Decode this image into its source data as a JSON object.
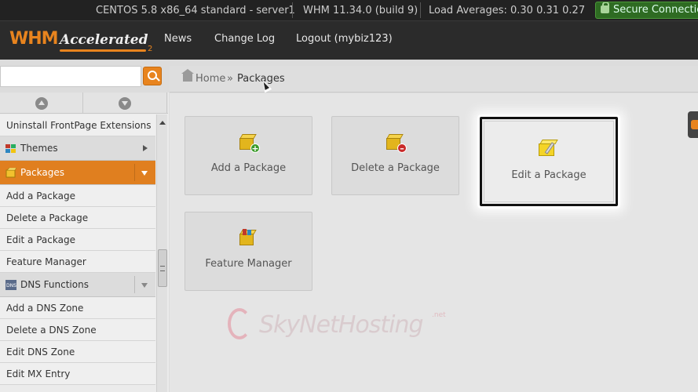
{
  "statusbar": {
    "server": "CENTOS 5.8 x86_64 standard - server1",
    "version": "WHM 11.34.0 (build 9)",
    "load": "Load Averages: 0.30 0.31 0.27",
    "secure": "Secure Connection"
  },
  "header": {
    "logo_main": "WHM",
    "logo_accent": "Accelerated",
    "logo_version": "2",
    "nav": [
      "News",
      "Change Log",
      "Logout (mybiz123)"
    ]
  },
  "search": {
    "placeholder": ""
  },
  "sidebar": {
    "items": [
      {
        "type": "item",
        "label": "Uninstall FrontPage Extensions"
      },
      {
        "type": "category",
        "label": "Themes",
        "icon": "themes-icon",
        "state": "collapsed"
      },
      {
        "type": "category",
        "label": "Packages",
        "icon": "packages-icon",
        "state": "active"
      },
      {
        "type": "item",
        "label": "Add a Package"
      },
      {
        "type": "item",
        "label": "Delete a Package"
      },
      {
        "type": "item",
        "label": "Edit a Package"
      },
      {
        "type": "item",
        "label": "Feature Manager"
      },
      {
        "type": "category",
        "label": "DNS Functions",
        "icon": "dns-icon",
        "state": "expanded"
      },
      {
        "type": "item",
        "label": "Add a DNS Zone"
      },
      {
        "type": "item",
        "label": "Delete a DNS Zone"
      },
      {
        "type": "item",
        "label": "Edit DNS Zone"
      },
      {
        "type": "item",
        "label": "Edit MX Entry"
      }
    ]
  },
  "breadcrumb": {
    "home": "Home",
    "separator": "»",
    "current": "Packages"
  },
  "tiles": [
    {
      "label": "Add a Package",
      "icon": "add-package-icon"
    },
    {
      "label": "Delete a Package",
      "icon": "delete-package-icon"
    },
    {
      "label": "Edit a Package",
      "icon": "edit-package-icon",
      "highlighted": true
    },
    {
      "label": "Feature Manager",
      "icon": "feature-manager-icon"
    }
  ],
  "watermark": {
    "text": "SkyNetHosting",
    "suffix": ".net"
  },
  "colors": {
    "accent": "#e07f1f",
    "header_bg": "#2b2b2b",
    "secure_green": "#2e6b22"
  }
}
